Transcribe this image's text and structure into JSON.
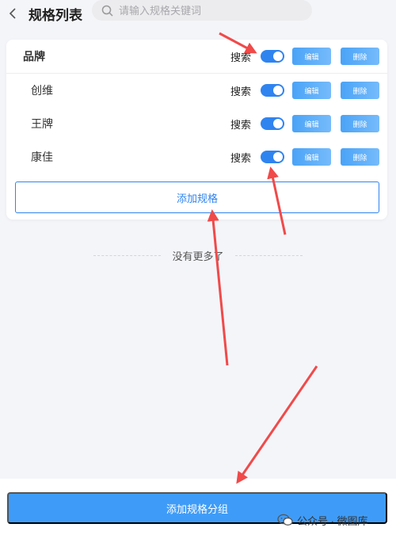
{
  "header": {
    "back_icon": "chevron-left-icon",
    "title": "规格列表",
    "search_icon": "search-icon",
    "search_placeholder": "请输入规格关键词",
    "search_value": ""
  },
  "spec_group": {
    "name": "品牌",
    "search_label": "搜索",
    "search_enabled": true,
    "edit_label": "编辑",
    "delete_label": "删除",
    "items": [
      {
        "name": "创维",
        "search_label": "搜索",
        "search_enabled": true,
        "edit_label": "编辑",
        "delete_label": "删除"
      },
      {
        "name": "王牌",
        "search_label": "搜索",
        "search_enabled": true,
        "edit_label": "编辑",
        "delete_label": "删除"
      },
      {
        "name": "康佳",
        "search_label": "搜索",
        "search_enabled": true,
        "edit_label": "编辑",
        "delete_label": "删除"
      }
    ],
    "add_spec_label": "添加规格"
  },
  "list_end_text": "没有更多了",
  "footer": {
    "add_group_label": "添加规格分组"
  },
  "watermark": {
    "text": "公众号 · 微图库",
    "icon": "wechat-icon"
  },
  "colors": {
    "accent": "#2f84f0",
    "button_gradient_start": "#4aa3f7",
    "button_gradient_end": "#76bbfb",
    "footer_button": "#3e9cf8",
    "annotation_arrow": "#f04a4a",
    "page_background": "#f4f5f9"
  }
}
